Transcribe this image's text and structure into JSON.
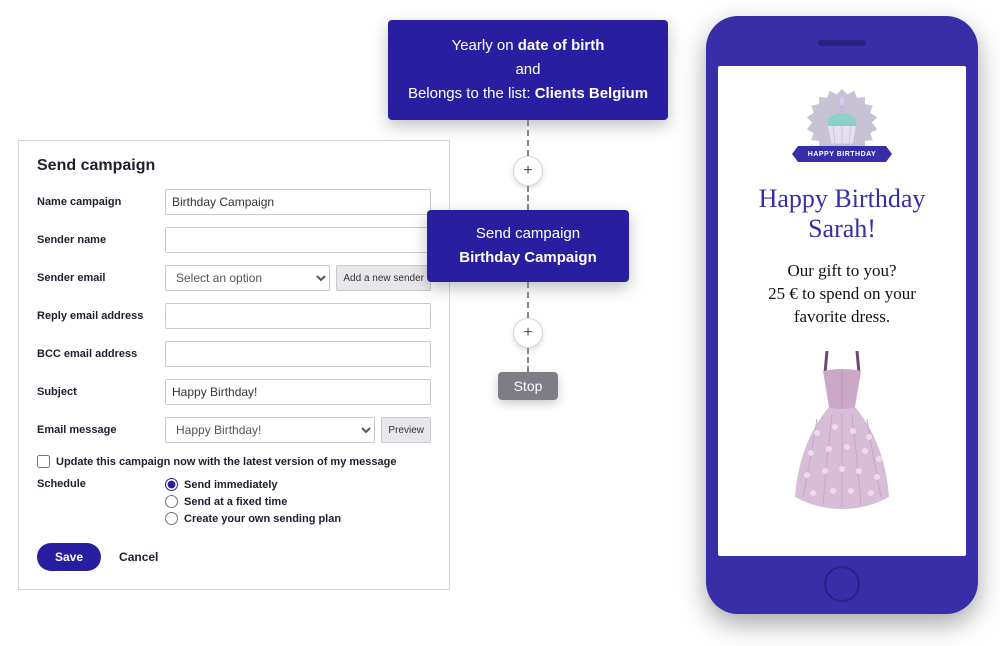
{
  "form": {
    "title": "Send campaign",
    "labels": {
      "name": "Name campaign",
      "sender_name": "Sender name",
      "sender_email": "Sender email",
      "reply": "Reply email address",
      "bcc": "BCC email address",
      "subject": "Subject",
      "message": "Email message",
      "schedule": "Schedule"
    },
    "values": {
      "name": "Birthday Campaign",
      "sender_name": "",
      "sender_email_placeholder": "Select an option",
      "reply": "",
      "bcc": "",
      "subject": "Happy Birthday!",
      "message_option": "Happy Birthday!"
    },
    "buttons": {
      "add_sender": "Add a new sender",
      "preview": "Preview",
      "save": "Save",
      "cancel": "Cancel"
    },
    "update_checkbox_label": "Update this campaign now with the latest version of my message",
    "schedule_options": [
      "Send immediately",
      "Send at a fixed time",
      "Create your own sending plan"
    ],
    "schedule_selected": 0
  },
  "flow": {
    "trigger": {
      "prefix": "Yearly on ",
      "bold1": "date of birth",
      "mid": "and",
      "list_prefix": "Belongs to the list: ",
      "bold2": "Clients Belgium"
    },
    "action": {
      "line1": "Send campaign",
      "line2": "Birthday Campaign"
    },
    "stop": "Stop",
    "plus": "+"
  },
  "phone": {
    "ribbon": "HAPPY BIRTHDAY",
    "greeting_line1": "Happy Birthday",
    "greeting_line2": "Sarah!",
    "offer_line1": "Our gift to you?",
    "offer_line2": "25 € to spend on your",
    "offer_line3": "favorite dress."
  }
}
